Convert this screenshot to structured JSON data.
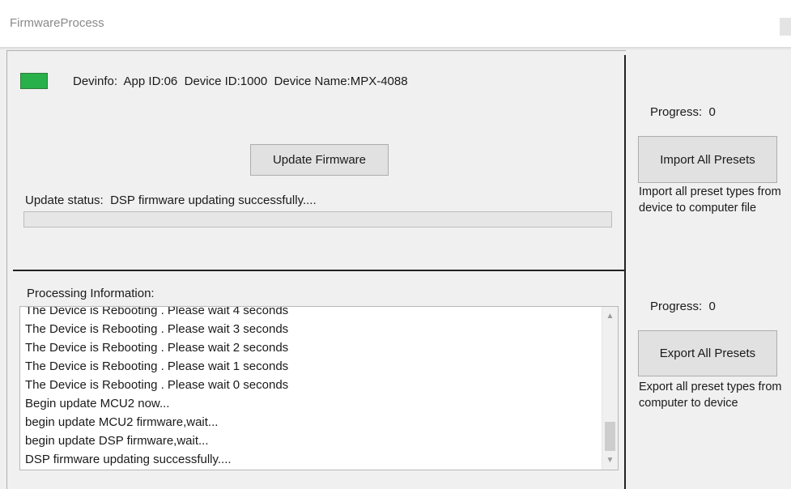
{
  "window": {
    "title": "FirmwareProcess"
  },
  "device": {
    "status_color": "#28b04a",
    "info_label": "Devinfo:",
    "app_id": "App ID:06",
    "device_id": "Device ID:1000",
    "device_name": "Device Name:MPX-4088"
  },
  "update": {
    "button_label": "Update Firmware",
    "status_label": "Update status:",
    "status_text": "DSP firmware updating successfully....",
    "progress": 0
  },
  "processing": {
    "label": "Processing Information:",
    "lines": [
      "The Device is Rebooting . Please wait 4 seconds",
      "The Device is Rebooting . Please wait 3 seconds",
      "The Device is Rebooting . Please wait 2 seconds",
      "The Device is Rebooting . Please wait 1 seconds",
      "The Device is Rebooting . Please wait 0 seconds",
      "Begin update MCU2 now...",
      "begin update MCU2 firmware,wait...",
      "begin update DSP firmware,wait...",
      "DSP firmware updating successfully...."
    ]
  },
  "import": {
    "progress_label": "Progress:",
    "progress_value": "0",
    "button_label": "Import All Presets",
    "description": "Import all preset types from device to computer file"
  },
  "export": {
    "progress_label": "Progress:",
    "progress_value": "0",
    "button_label": "Export All Presets",
    "description": "Export all preset types from computer to device"
  }
}
